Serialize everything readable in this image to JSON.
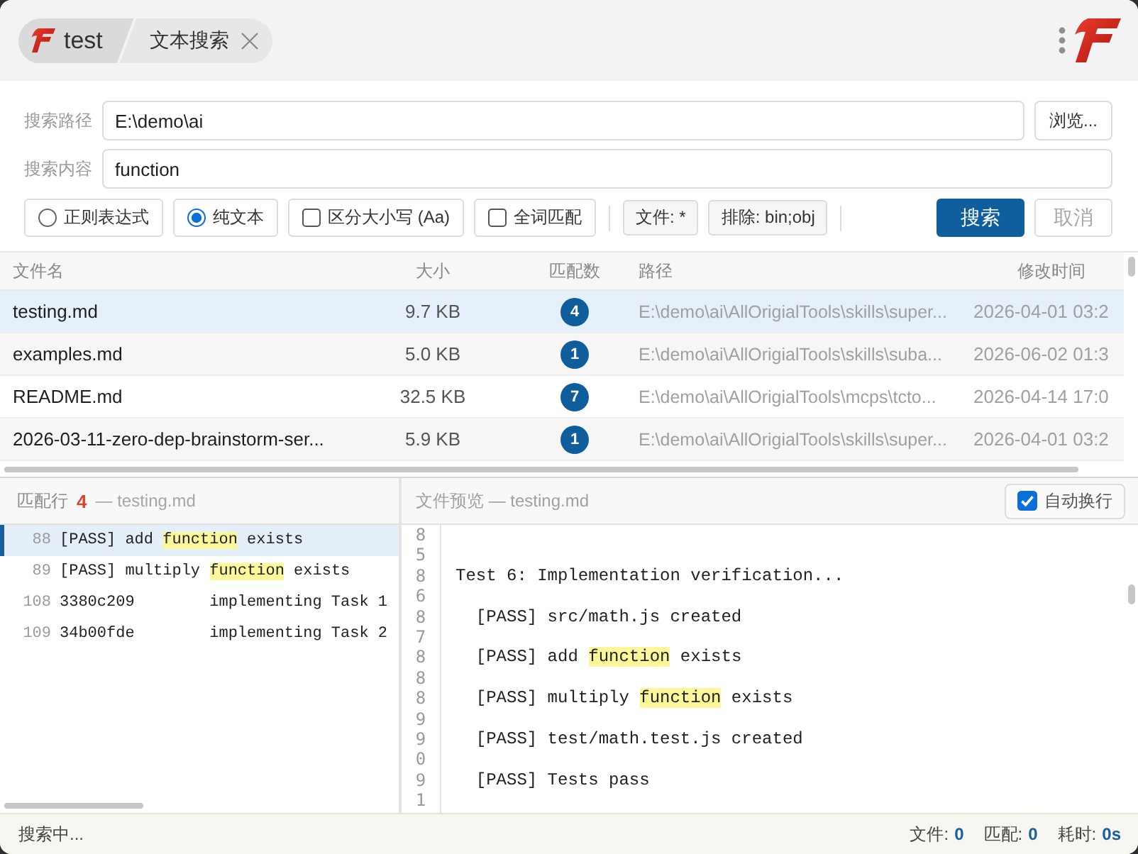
{
  "title_bar": {
    "home_tab": {
      "label": "test"
    },
    "tabs": [
      {
        "label": "文本搜索",
        "closable": true
      }
    ]
  },
  "search_form": {
    "path": {
      "label": "搜索路径",
      "value": "E:\\demo\\ai",
      "browse_button": "浏览..."
    },
    "query": {
      "label": "搜索内容",
      "value": "function"
    },
    "modes": [
      {
        "label": "正则表达式",
        "selected": false
      },
      {
        "label": "纯文本",
        "selected": true
      }
    ],
    "flags": [
      {
        "label": "区分大小写 (Aa)",
        "checked": false
      },
      {
        "label": "全词匹配",
        "checked": false
      }
    ],
    "filters": [
      "文件: *",
      "排除: bin;obj"
    ],
    "actions": [
      {
        "label": "搜索",
        "kind": "primary",
        "disabled": false
      },
      {
        "label": "取消",
        "kind": "default",
        "disabled": true
      }
    ]
  },
  "results": {
    "columns": [
      "文件名",
      "大小",
      "匹配数",
      "路径",
      "修改时间"
    ],
    "rows": [
      {
        "name": "testing.md",
        "size": "9.7 KB",
        "matches": "4",
        "path": "E:\\demo\\ai\\AllOrigialTools\\skills\\super...",
        "modified": "2026-04-01 03:2",
        "selected": true
      },
      {
        "name": "examples.md",
        "size": "5.0 KB",
        "matches": "1",
        "path": "E:\\demo\\ai\\AllOrigialTools\\skills\\suba...",
        "modified": "2026-06-02 01:3",
        "selected": false
      },
      {
        "name": "README.md",
        "size": "32.5 KB",
        "matches": "7",
        "path": "E:\\demo\\ai\\AllOrigialTools\\mcps\\tcto...",
        "modified": "2026-04-14 17:0",
        "selected": false
      },
      {
        "name": "2026-03-11-zero-dep-brainstorm-ser...",
        "size": "5.9 KB",
        "matches": "1",
        "path": "E:\\demo\\ai\\AllOrigialTools\\skills\\super...",
        "modified": "2026-04-01 03:2",
        "selected": false
      }
    ]
  },
  "match_lines": {
    "title": "匹配行",
    "count": "4",
    "file": "— testing.md",
    "lines": [
      {
        "number": "88",
        "text": "[PASS] add ",
        "match": "function",
        "after": " exists",
        "selected": true
      },
      {
        "number": "89",
        "text": "[PASS] multiply ",
        "match": "function",
        "after": " exists",
        "selected": false
      },
      {
        "number": "108",
        "text": "3380c209        implementing Task 1",
        "selected": false
      },
      {
        "number": "109",
        "text": "34b00fde        implementing Task 2",
        "selected": false
      }
    ]
  },
  "preview": {
    "title": "文件预览 — testing.md",
    "word_wrap": {
      "label": "自动换行",
      "checked": true
    },
    "lines": [
      {
        "number": "85"
      },
      {
        "number": "86",
        "text": "Test 6: Implementation verification..."
      },
      {
        "number": "87",
        "text": "  [PASS] src/math.js created"
      },
      {
        "number": "88",
        "text": "  [PASS] add ",
        "match": "function",
        "after": " exists"
      },
      {
        "number": "89",
        "text": "  [PASS] multiply ",
        "match": "function",
        "after": " exists"
      },
      {
        "number": "90",
        "text": "  [PASS] test/math.test.js created"
      },
      {
        "number": "91",
        "text": "  [PASS] Tests pass"
      }
    ]
  },
  "status_bar": {
    "message": "搜索中...",
    "stats": [
      {
        "label": "文件:",
        "value": "0"
      },
      {
        "label": "匹配:",
        "value": "0"
      },
      {
        "label": "耗时:",
        "value": "0s"
      }
    ]
  }
}
